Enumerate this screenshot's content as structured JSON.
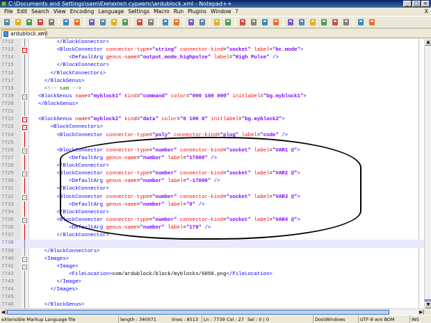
{
  "window": {
    "title": "C:\\Documents and Settings\\sam\\Ємпюпєп суриепс\\ardublock.xml - Notepad++",
    "buttons": {
      "minimize": "_",
      "maximize": "□",
      "close": "×"
    }
  },
  "menu": {
    "items": [
      "File",
      "Edit",
      "Search",
      "View",
      "Encoding",
      "Language",
      "Settings",
      "Macro",
      "Run",
      "Plugins",
      "Window",
      "?"
    ],
    "close": "X"
  },
  "toolbar": {
    "icons": [
      "new-file-icon",
      "open-file-icon",
      "save-icon",
      "save-all-icon",
      "close-icon",
      "close-all-icon",
      "print-icon",
      "cut-icon",
      "copy-icon",
      "paste-icon",
      "undo-icon",
      "redo-icon",
      "find-icon",
      "replace-icon",
      "zoom-in-icon",
      "zoom-out-icon",
      "sync-vertical-icon",
      "sync-horizontal-icon",
      "wrap-icon",
      "all-chars-icon",
      "indent-guide-icon",
      "user-lang-icon",
      "doc-map-icon",
      "function-list-icon",
      "record-macro-icon",
      "stop-macro-icon",
      "play-macro-icon",
      "run-macro-icon",
      "save-macro-icon",
      "spellcheck-icon",
      "abc-icon"
    ]
  },
  "tab": {
    "label": "ardublock.xml",
    "close": "×"
  },
  "editor": {
    "current_line_index": 26
  },
  "lines": [
    {
      "n": "7712",
      "parts": [
        [
          "x",
          "        "
        ],
        [
          "t",
          "</BlockConnector>"
        ]
      ]
    },
    {
      "n": "7713",
      "parts": [
        [
          "x",
          "        "
        ],
        [
          "t",
          "<BlockConnector "
        ],
        [
          "a",
          "connector-type"
        ],
        [
          "x",
          "="
        ],
        [
          "v",
          "\"string\""
        ],
        [
          "x",
          " "
        ],
        [
          "a",
          "connector-kind"
        ],
        [
          "x",
          "="
        ],
        [
          "v",
          "\"socket\""
        ],
        [
          "x",
          " "
        ],
        [
          "a",
          "label"
        ],
        [
          "x",
          "="
        ],
        [
          "v",
          "\"bc.mode\""
        ],
        [
          "t",
          ">"
        ]
      ]
    },
    {
      "n": "7714",
      "parts": [
        [
          "x",
          "            "
        ],
        [
          "t",
          "<DefaultArg "
        ],
        [
          "a",
          "genus-name"
        ],
        [
          "x",
          "="
        ],
        [
          "v",
          "\"output_mode_highpulse\""
        ],
        [
          "x",
          " "
        ],
        [
          "a",
          "label"
        ],
        [
          "x",
          "="
        ],
        [
          "v",
          "\"High Pulse\""
        ],
        [
          "x",
          " "
        ],
        [
          "t",
          "/>"
        ]
      ]
    },
    {
      "n": "7715",
      "parts": [
        [
          "x",
          "        "
        ],
        [
          "t",
          "</BlockConnector>"
        ]
      ]
    },
    {
      "n": "7716",
      "parts": [
        [
          "x",
          "      "
        ],
        [
          "t",
          "</BlockConnectors>"
        ]
      ]
    },
    {
      "n": "7717",
      "parts": [
        [
          "x",
          "    "
        ],
        [
          "t",
          "</BlockGenus>"
        ]
      ]
    },
    {
      "n": "7718",
      "parts": [
        [
          "x",
          "    "
        ],
        [
          "c",
          "<!-- sam -->"
        ]
      ]
    },
    {
      "n": "7719",
      "parts": [
        [
          "x",
          "  "
        ],
        [
          "t",
          "<BlockGenus "
        ],
        [
          "a",
          "name"
        ],
        [
          "x",
          "="
        ],
        [
          "v",
          "\"myblock1\""
        ],
        [
          "x",
          " "
        ],
        [
          "a",
          "kind"
        ],
        [
          "x",
          "="
        ],
        [
          "v",
          "\"command\""
        ],
        [
          "x",
          " "
        ],
        [
          "a",
          "color"
        ],
        [
          "x",
          "="
        ],
        [
          "v",
          "\"000 100 000\""
        ],
        [
          "x",
          " "
        ],
        [
          "a",
          "initlabel"
        ],
        [
          "x",
          "="
        ],
        [
          "v",
          "\"bg.myblock1\""
        ],
        [
          "t",
          ">"
        ]
      ]
    },
    {
      "n": "7720",
      "parts": [
        [
          "x",
          "  "
        ],
        [
          "t",
          "</BlockGenus>"
        ]
      ]
    },
    {
      "n": "7721",
      "parts": []
    },
    {
      "n": "7722",
      "parts": [
        [
          "x",
          "  "
        ],
        [
          "t",
          "<BlockGenus "
        ],
        [
          "a",
          "name"
        ],
        [
          "x",
          "="
        ],
        [
          "v",
          "\"myblock2\""
        ],
        [
          "x",
          " "
        ],
        [
          "a",
          "kind"
        ],
        [
          "x",
          "="
        ],
        [
          "v",
          "\"data\""
        ],
        [
          "x",
          " "
        ],
        [
          "a",
          "color"
        ],
        [
          "x",
          "="
        ],
        [
          "v",
          "\"0 100 0\""
        ],
        [
          "x",
          " "
        ],
        [
          "a",
          "initlabel"
        ],
        [
          "x",
          "="
        ],
        [
          "v",
          "\"bg.myblock2\""
        ],
        [
          "t",
          ">"
        ]
      ]
    },
    {
      "n": "7723",
      "parts": [
        [
          "x",
          "      "
        ],
        [
          "t",
          "<BlockConnectors>"
        ]
      ]
    },
    {
      "n": "7724",
      "parts": [
        [
          "x",
          "        "
        ],
        [
          "t",
          "<BlockConnector "
        ],
        [
          "a",
          "connector-type"
        ],
        [
          "x",
          "="
        ],
        [
          "v",
          "\"poly\""
        ],
        [
          "x",
          " "
        ],
        [
          "a",
          "connector-kind"
        ],
        [
          "x",
          "="
        ],
        [
          "v",
          "\"plug\""
        ],
        [
          "x",
          " "
        ],
        [
          "a",
          "label"
        ],
        [
          "x",
          "="
        ],
        [
          "v",
          "\"code\""
        ],
        [
          "x",
          " "
        ],
        [
          "t",
          "/>"
        ]
      ]
    },
    {
      "n": "7725",
      "parts": []
    },
    {
      "n": "7726",
      "parts": [
        [
          "x",
          "        "
        ],
        [
          "t",
          "<BlockConnector "
        ],
        [
          "a",
          "connector-type"
        ],
        [
          "x",
          "="
        ],
        [
          "v",
          "\"number\""
        ],
        [
          "x",
          " "
        ],
        [
          "a",
          "connector-kind"
        ],
        [
          "x",
          "="
        ],
        [
          "v",
          "\"socket\""
        ],
        [
          "x",
          " "
        ],
        [
          "a",
          "label"
        ],
        [
          "x",
          "="
        ],
        [
          "v",
          "\"VAR1 @\""
        ],
        [
          "t",
          ">"
        ]
      ]
    },
    {
      "n": "7727",
      "parts": [
        [
          "x",
          "            "
        ],
        [
          "t",
          "<DefaultArg "
        ],
        [
          "a",
          "genus-name"
        ],
        [
          "x",
          "="
        ],
        [
          "v",
          "\"number\""
        ],
        [
          "x",
          " "
        ],
        [
          "a",
          "label"
        ],
        [
          "x",
          "="
        ],
        [
          "v",
          "\"17000\""
        ],
        [
          "x",
          " "
        ],
        [
          "t",
          "/>"
        ]
      ]
    },
    {
      "n": "7728",
      "parts": [
        [
          "x",
          "        "
        ],
        [
          "t",
          "</BlockConnector>"
        ]
      ]
    },
    {
      "n": "7729",
      "parts": [
        [
          "x",
          "        "
        ],
        [
          "t",
          "<BlockConnector "
        ],
        [
          "a",
          "connector-type"
        ],
        [
          "x",
          "="
        ],
        [
          "v",
          "\"number\""
        ],
        [
          "x",
          " "
        ],
        [
          "a",
          "connector-kind"
        ],
        [
          "x",
          "="
        ],
        [
          "v",
          "\"socket\""
        ],
        [
          "x",
          " "
        ],
        [
          "a",
          "label"
        ],
        [
          "x",
          "="
        ],
        [
          "v",
          "\"VAR2 @\""
        ],
        [
          "t",
          ">"
        ]
      ]
    },
    {
      "n": "7730",
      "parts": [
        [
          "x",
          "            "
        ],
        [
          "t",
          "<DefaultArg "
        ],
        [
          "a",
          "genus-name"
        ],
        [
          "x",
          "="
        ],
        [
          "v",
          "\"number\""
        ],
        [
          "x",
          " "
        ],
        [
          "a",
          "label"
        ],
        [
          "x",
          "="
        ],
        [
          "v",
          "\"-17000\""
        ],
        [
          "x",
          " "
        ],
        [
          "t",
          "/>"
        ]
      ]
    },
    {
      "n": "7731",
      "parts": [
        [
          "x",
          "        "
        ],
        [
          "t",
          "</BlockConnector>"
        ]
      ]
    },
    {
      "n": "7732",
      "parts": [
        [
          "x",
          "        "
        ],
        [
          "t",
          "<BlockConnector "
        ],
        [
          "a",
          "connector-type"
        ],
        [
          "x",
          "="
        ],
        [
          "v",
          "\"number\""
        ],
        [
          "x",
          " "
        ],
        [
          "a",
          "connector-kind"
        ],
        [
          "x",
          "="
        ],
        [
          "v",
          "\"socket\""
        ],
        [
          "x",
          " "
        ],
        [
          "a",
          "label"
        ],
        [
          "x",
          "="
        ],
        [
          "v",
          "\"VAR3 @\""
        ],
        [
          "t",
          ">"
        ]
      ]
    },
    {
      "n": "7733",
      "parts": [
        [
          "x",
          "            "
        ],
        [
          "t",
          "<DefaultArg "
        ],
        [
          "a",
          "genus-name"
        ],
        [
          "x",
          "="
        ],
        [
          "v",
          "\"number\""
        ],
        [
          "x",
          " "
        ],
        [
          "a",
          "label"
        ],
        [
          "x",
          "="
        ],
        [
          "v",
          "\"0\""
        ],
        [
          "x",
          " "
        ],
        [
          "t",
          "/>"
        ]
      ]
    },
    {
      "n": "7734",
      "parts": [
        [
          "x",
          "        "
        ],
        [
          "t",
          "</BlockConnector>"
        ]
      ]
    },
    {
      "n": "7735",
      "parts": [
        [
          "x",
          "        "
        ],
        [
          "t",
          "<BlockConnector "
        ],
        [
          "a",
          "connector-type"
        ],
        [
          "x",
          "="
        ],
        [
          "v",
          "\"number\""
        ],
        [
          "x",
          " "
        ],
        [
          "a",
          "connector-kind"
        ],
        [
          "x",
          "="
        ],
        [
          "v",
          "\"socket\""
        ],
        [
          "x",
          " "
        ],
        [
          "a",
          "label"
        ],
        [
          "x",
          "="
        ],
        [
          "v",
          "\"VAR4 @\""
        ],
        [
          "t",
          ">"
        ]
      ]
    },
    {
      "n": "7736",
      "parts": [
        [
          "x",
          "            "
        ],
        [
          "t",
          "<DefaultArg "
        ],
        [
          "a",
          "genus-name"
        ],
        [
          "x",
          "="
        ],
        [
          "v",
          "\"number\""
        ],
        [
          "x",
          " "
        ],
        [
          "a",
          "label"
        ],
        [
          "x",
          "="
        ],
        [
          "v",
          "\"179\""
        ],
        [
          "x",
          " "
        ],
        [
          "t",
          "/>"
        ]
      ]
    },
    {
      "n": "7737",
      "parts": [
        [
          "x",
          "        "
        ],
        [
          "t",
          "</BlockConnector>"
        ]
      ]
    },
    {
      "n": "7738",
      "parts": []
    },
    {
      "n": "7739",
      "parts": [
        [
          "x",
          "    "
        ],
        [
          "t",
          "</BlockConnectors>"
        ]
      ]
    },
    {
      "n": "7740",
      "parts": [
        [
          "x",
          "    "
        ],
        [
          "t",
          "<Images>"
        ]
      ]
    },
    {
      "n": "7741",
      "parts": [
        [
          "x",
          "        "
        ],
        [
          "t",
          "<Image>"
        ]
      ]
    },
    {
      "n": "7742",
      "parts": [
        [
          "x",
          "            "
        ],
        [
          "t",
          "<FileLocation>"
        ],
        [
          "x",
          "com/ardublock/block/myblocks/6050.png"
        ],
        [
          "t",
          "</FileLocation>"
        ]
      ]
    },
    {
      "n": "7743",
      "parts": [
        [
          "x",
          "        "
        ],
        [
          "t",
          "</Image>"
        ]
      ]
    },
    {
      "n": "7744",
      "parts": [
        [
          "x",
          "      "
        ],
        [
          "t",
          "</Images>"
        ]
      ]
    },
    {
      "n": "7745",
      "parts": []
    },
    {
      "n": "7746",
      "parts": [
        [
          "x",
          "    "
        ],
        [
          "t",
          "</BlockGenus>"
        ]
      ]
    }
  ],
  "status": {
    "file_type": "eXtensible Markup Language file",
    "length": "length : 340071",
    "lines": "lines : 8513",
    "position": "Ln : 7739",
    "col": "Col : 27",
    "sel": "Sel : 0 | 0",
    "eol": "Dos\\Windows",
    "encoding": "UTF-8 w/o BOM",
    "mode": "INS"
  },
  "colors": {
    "tag": "#0000ff",
    "attribute": "#ff0000",
    "value": "#8000ff",
    "comment": "#008000",
    "current_line": "#e8e8ff"
  }
}
